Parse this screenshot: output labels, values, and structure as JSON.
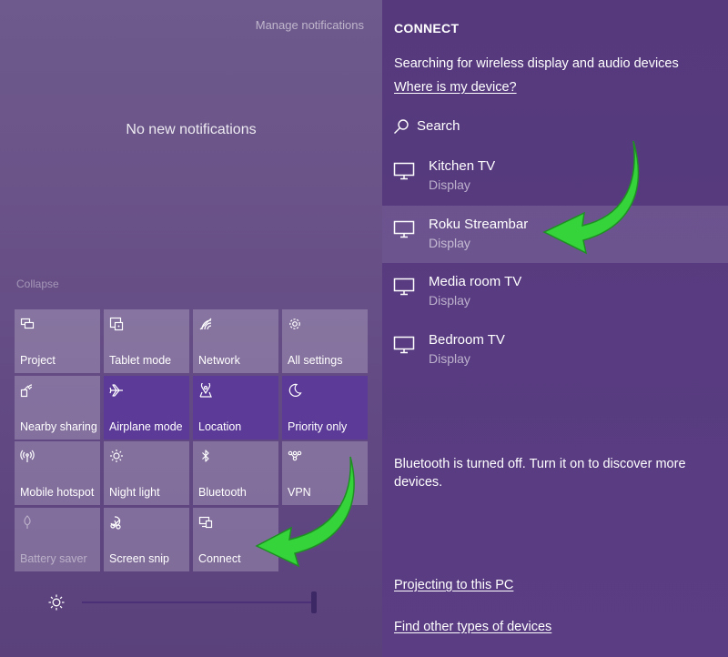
{
  "action_center": {
    "manage_notifications": "Manage notifications",
    "no_notifications": "No new notifications",
    "collapse": "Collapse",
    "tiles": [
      {
        "label": "Project",
        "icon": "project-icon",
        "state": "off"
      },
      {
        "label": "Tablet mode",
        "icon": "tablet-mode-icon",
        "state": "off"
      },
      {
        "label": "Network",
        "icon": "network-icon",
        "state": "off"
      },
      {
        "label": "All settings",
        "icon": "gear-icon",
        "state": "off"
      },
      {
        "label": "Nearby sharing",
        "icon": "nearby-sharing-icon",
        "state": "off"
      },
      {
        "label": "Airplane mode",
        "icon": "airplane-icon",
        "state": "on"
      },
      {
        "label": "Location",
        "icon": "location-icon",
        "state": "on"
      },
      {
        "label": "Priority only",
        "icon": "moon-icon",
        "state": "on"
      },
      {
        "label": "Mobile hotspot",
        "icon": "hotspot-icon",
        "state": "off"
      },
      {
        "label": "Night light",
        "icon": "sun-icon",
        "state": "off"
      },
      {
        "label": "Bluetooth",
        "icon": "bluetooth-icon",
        "state": "off"
      },
      {
        "label": "VPN",
        "icon": "vpn-icon",
        "state": "off"
      },
      {
        "label": "Battery saver",
        "icon": "battery-saver-icon",
        "state": "disabled"
      },
      {
        "label": "Screen snip",
        "icon": "screen-snip-icon",
        "state": "off"
      },
      {
        "label": "Connect",
        "icon": "connect-icon",
        "state": "off"
      }
    ],
    "brightness": {
      "icon": "brightness-icon",
      "level": 1.0
    }
  },
  "connect": {
    "title": "CONNECT",
    "searching": "Searching for wireless display and audio devices",
    "where_link": "Where is my device?",
    "search_label": "Search",
    "devices": [
      {
        "name": "Kitchen TV",
        "type": "Display",
        "selected": false
      },
      {
        "name": "Roku Streambar",
        "type": "Display",
        "selected": true
      },
      {
        "name": "Media room TV",
        "type": "Display",
        "selected": false
      },
      {
        "name": "Bedroom TV",
        "type": "Display",
        "selected": false
      }
    ],
    "bluetooth_message": "Bluetooth is turned off. Turn it on to discover more devices.",
    "projecting_link": "Projecting to this PC",
    "find_other_link": "Find other types of devices"
  },
  "colors": {
    "tile_on": "#5c3a98",
    "annotation_arrow": "#35d43b"
  }
}
